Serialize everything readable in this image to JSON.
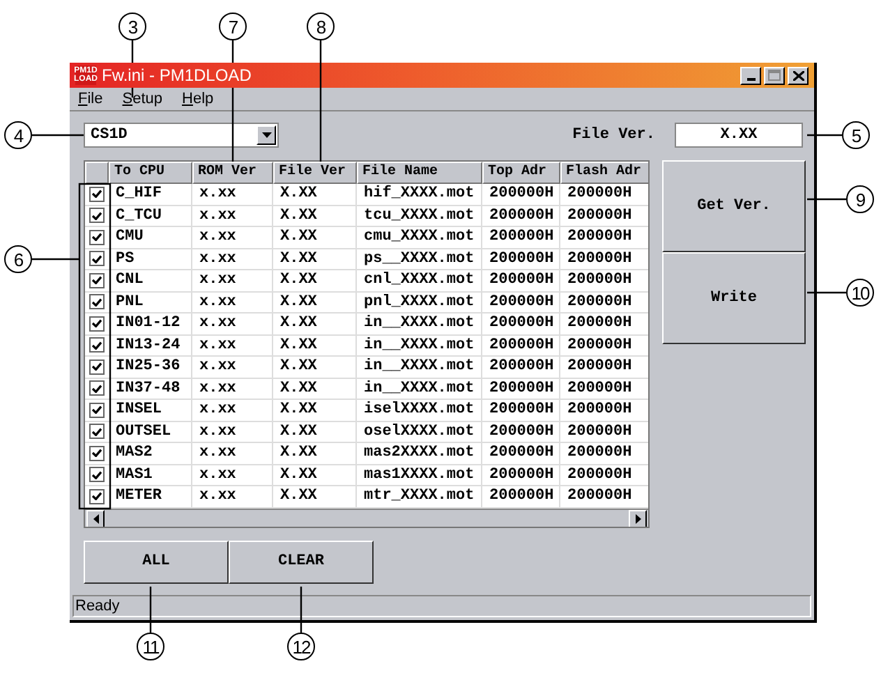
{
  "window": {
    "icon_lines": [
      "PM1D",
      "LOAD"
    ],
    "title": "Fw.ini - PM1DLOAD"
  },
  "menu": [
    "File",
    "Setup",
    "Help"
  ],
  "cpu_select": {
    "value": "CS1D"
  },
  "file_ver": {
    "label": "File Ver.",
    "value": "X.XX"
  },
  "table": {
    "columns": [
      "To CPU",
      "ROM Ver",
      "File Ver",
      "File Name",
      "Top Adr",
      "Flash Adr"
    ],
    "rows": [
      {
        "checked": true,
        "cells": [
          "C_HIF",
          "x.xx",
          "X.XX",
          "hif_XXXX.mot",
          "200000H",
          "200000H"
        ]
      },
      {
        "checked": true,
        "cells": [
          "C_TCU",
          "x.xx",
          "X.XX",
          "tcu_XXXX.mot",
          "200000H",
          "200000H"
        ]
      },
      {
        "checked": true,
        "cells": [
          "CMU",
          "x.xx",
          "X.XX",
          "cmu_XXXX.mot",
          "200000H",
          "200000H"
        ]
      },
      {
        "checked": true,
        "cells": [
          "PS",
          "x.xx",
          "X.XX",
          "ps__XXXX.mot",
          "200000H",
          "200000H"
        ]
      },
      {
        "checked": true,
        "cells": [
          "CNL",
          "x.xx",
          "X.XX",
          "cnl_XXXX.mot",
          "200000H",
          "200000H"
        ]
      },
      {
        "checked": true,
        "cells": [
          "PNL",
          "x.xx",
          "X.XX",
          "pnl_XXXX.mot",
          "200000H",
          "200000H"
        ]
      },
      {
        "checked": true,
        "cells": [
          "IN01-12",
          "x.xx",
          "X.XX",
          "in__XXXX.mot",
          "200000H",
          "200000H"
        ]
      },
      {
        "checked": true,
        "cells": [
          "IN13-24",
          "x.xx",
          "X.XX",
          "in__XXXX.mot",
          "200000H",
          "200000H"
        ]
      },
      {
        "checked": true,
        "cells": [
          "IN25-36",
          "x.xx",
          "X.XX",
          "in__XXXX.mot",
          "200000H",
          "200000H"
        ]
      },
      {
        "checked": true,
        "cells": [
          "IN37-48",
          "x.xx",
          "X.XX",
          "in__XXXX.mot",
          "200000H",
          "200000H"
        ]
      },
      {
        "checked": true,
        "cells": [
          "INSEL",
          "x.xx",
          "X.XX",
          "iselXXXX.mot",
          "200000H",
          "200000H"
        ]
      },
      {
        "checked": true,
        "cells": [
          "OUTSEL",
          "x.xx",
          "X.XX",
          "oselXXXX.mot",
          "200000H",
          "200000H"
        ]
      },
      {
        "checked": true,
        "cells": [
          "MAS2",
          "x.xx",
          "X.XX",
          "mas2XXXX.mot",
          "200000H",
          "200000H"
        ]
      },
      {
        "checked": true,
        "cells": [
          "MAS1",
          "x.xx",
          "X.XX",
          "mas1XXXX.mot",
          "200000H",
          "200000H"
        ]
      },
      {
        "checked": true,
        "cells": [
          "METER",
          "x.xx",
          "X.XX",
          "mtr_XXXX.mot",
          "200000H",
          "200000H"
        ]
      }
    ]
  },
  "side_buttons": [
    "Get Ver.",
    "Write"
  ],
  "bottom_buttons": [
    "ALL",
    "CLEAR"
  ],
  "status_bar": "Ready",
  "callouts": [
    "3",
    "7",
    "8",
    "4",
    "5",
    "6",
    "9",
    "10",
    "11",
    "12"
  ]
}
